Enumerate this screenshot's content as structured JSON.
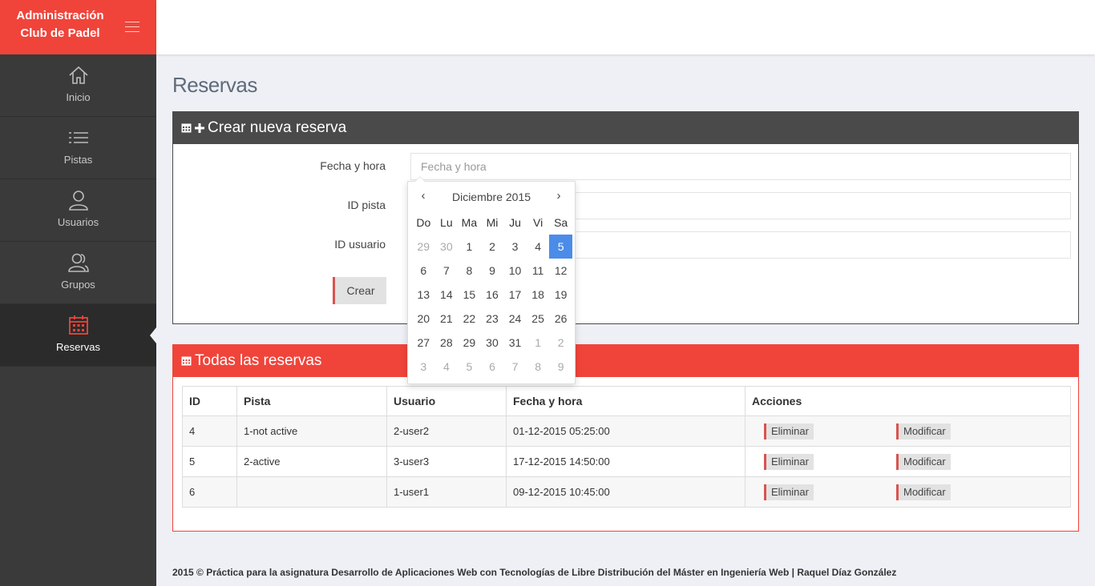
{
  "brand": {
    "line1": "Administración",
    "line2": "Club de Padel"
  },
  "sidebar": {
    "items": [
      {
        "label": "Inicio",
        "icon": "home-icon"
      },
      {
        "label": "Pistas",
        "icon": "list-icon"
      },
      {
        "label": "Usuarios",
        "icon": "user-icon"
      },
      {
        "label": "Grupos",
        "icon": "users-icon"
      },
      {
        "label": "Reservas",
        "icon": "calendar-icon",
        "active": true
      }
    ]
  },
  "page": {
    "title": "Reservas"
  },
  "create_panel": {
    "title": "Crear nueva reserva",
    "fields": {
      "fecha": {
        "label": "Fecha y hora",
        "placeholder": "Fecha y hora",
        "value": ""
      },
      "pista": {
        "label": "ID pista",
        "value": ""
      },
      "usuario": {
        "label": "ID usuario",
        "value": ""
      }
    },
    "submit_label": "Crear"
  },
  "datepicker": {
    "month": "Diciembre 2015",
    "prev": "‹",
    "next": "›",
    "weekdays": [
      "Do",
      "Lu",
      "Ma",
      "Mi",
      "Ju",
      "Vi",
      "Sa"
    ],
    "weeks": [
      [
        "29",
        "30",
        "1",
        "2",
        "3",
        "4",
        "5"
      ],
      [
        "6",
        "7",
        "8",
        "9",
        "10",
        "11",
        "12"
      ],
      [
        "13",
        "14",
        "15",
        "16",
        "17",
        "18",
        "19"
      ],
      [
        "20",
        "21",
        "22",
        "23",
        "24",
        "25",
        "26"
      ],
      [
        "27",
        "28",
        "29",
        "30",
        "31",
        "1",
        "2"
      ],
      [
        "3",
        "4",
        "5",
        "6",
        "7",
        "8",
        "9"
      ]
    ],
    "selected_day": "5"
  },
  "list_panel": {
    "title": "Todas las reservas",
    "columns": [
      "ID",
      "Pista",
      "Usuario",
      "Fecha y hora",
      "Acciones"
    ],
    "rows": [
      {
        "id": "4",
        "pista": "1-not active",
        "usuario": "2-user2",
        "fecha": "01-12-2015 05:25:00"
      },
      {
        "id": "5",
        "pista": "2-active",
        "usuario": "3-user3",
        "fecha": "17-12-2015 14:50:00"
      },
      {
        "id": "6",
        "pista": "",
        "usuario": "1-user1",
        "fecha": "09-12-2015 10:45:00"
      }
    ],
    "delete_label": "Eliminar",
    "edit_label": "Modificar"
  },
  "footer": {
    "text": "2015 © Práctica para la asignatura Desarrollo de Aplicaciones Web con Tecnologías de Libre Distribución del Máster en Ingeniería Web | Raquel Díaz González"
  },
  "colors": {
    "accent": "#f0443a",
    "sidebar": "#3a3a3a",
    "dark_panel": "#4a4a4a",
    "selected_day": "#4b8ce8"
  }
}
